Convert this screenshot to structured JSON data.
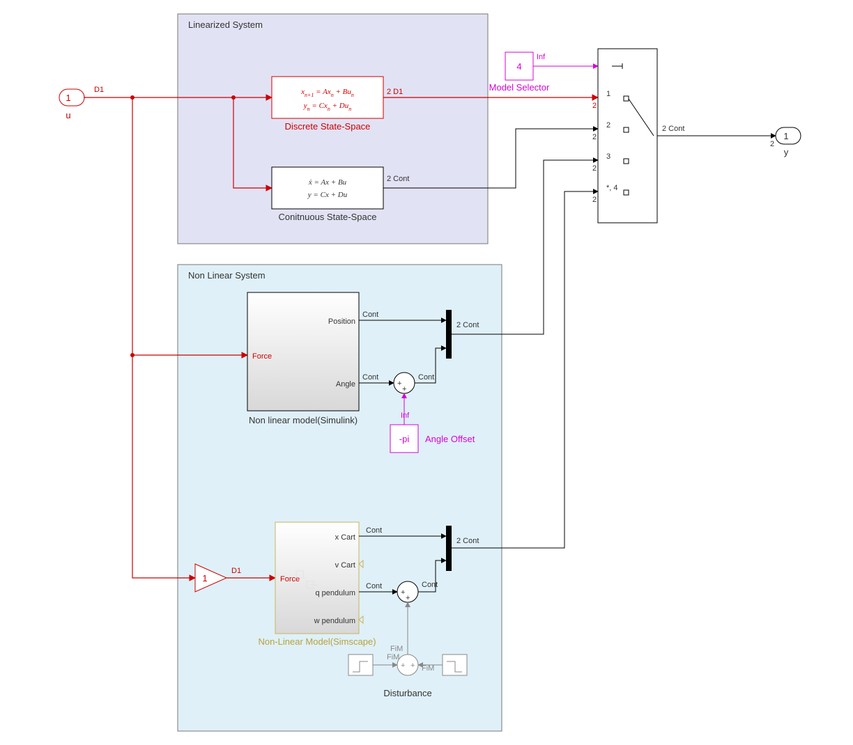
{
  "areas": {
    "linear": {
      "title": "Linearized System"
    },
    "nonlinear": {
      "title": "Non Linear System"
    }
  },
  "inport": {
    "num": "1",
    "name": "u",
    "sig": "D1"
  },
  "outport": {
    "num": "1",
    "name": "y",
    "sig": "2 Cont",
    "dim": "2"
  },
  "discreteSS": {
    "name": "Discrete  State-Space",
    "eq1a": "x",
    "eq1sub": "n+1",
    "eq1b": " = Ax",
    "eq1sub2": "n",
    "eq1c": " + Bu",
    "eq1sub3": "n",
    "eq2a": "y",
    "eq2sub": "n",
    "eq2b": " = Cx",
    "eq2sub2": "n",
    "eq2c": " + Du",
    "eq2sub3": "n",
    "out": "2 D1"
  },
  "contSS": {
    "name": "Conitnuous State-Space",
    "eq1": "ẋ = Ax + Bu",
    "eq2": "y = Cx + Du",
    "out": "2 Cont"
  },
  "modelSelector": {
    "value": "4",
    "rate": "Inf",
    "name": "Model Selector"
  },
  "multiport": {
    "p1": {
      "label": "1",
      "dim": "2"
    },
    "p2": {
      "label": "2",
      "dim": "2"
    },
    "p3": {
      "label": "3",
      "dim": "2"
    },
    "p4": {
      "label": "*, 4",
      "dim": "2"
    }
  },
  "nlSimulink": {
    "name": "Non linear model(Simulink)",
    "in": "Force",
    "out1": "Position",
    "out1rate": "Cont",
    "out2": "Angle",
    "out2rate": "Cont"
  },
  "angleOffset": {
    "value": "-pi",
    "rate": "Inf",
    "name": "Angle Offset"
  },
  "sumOut": "Cont",
  "mux1out": "2 Cont",
  "gain": {
    "value": "1",
    "sig": "D1"
  },
  "nlSimscape": {
    "name": "Non-Linear Model(Simscape)",
    "in": "Force",
    "out1": "x Cart",
    "out1rate": "Cont",
    "out2": "v Cart",
    "out3": "q pendulum",
    "out3rate": "Cont",
    "out4": "w pendulum"
  },
  "mux2out": "2 Cont",
  "sum2out": "Cont",
  "disturbance": {
    "name": "Disturbance",
    "rate": "FiM"
  }
}
